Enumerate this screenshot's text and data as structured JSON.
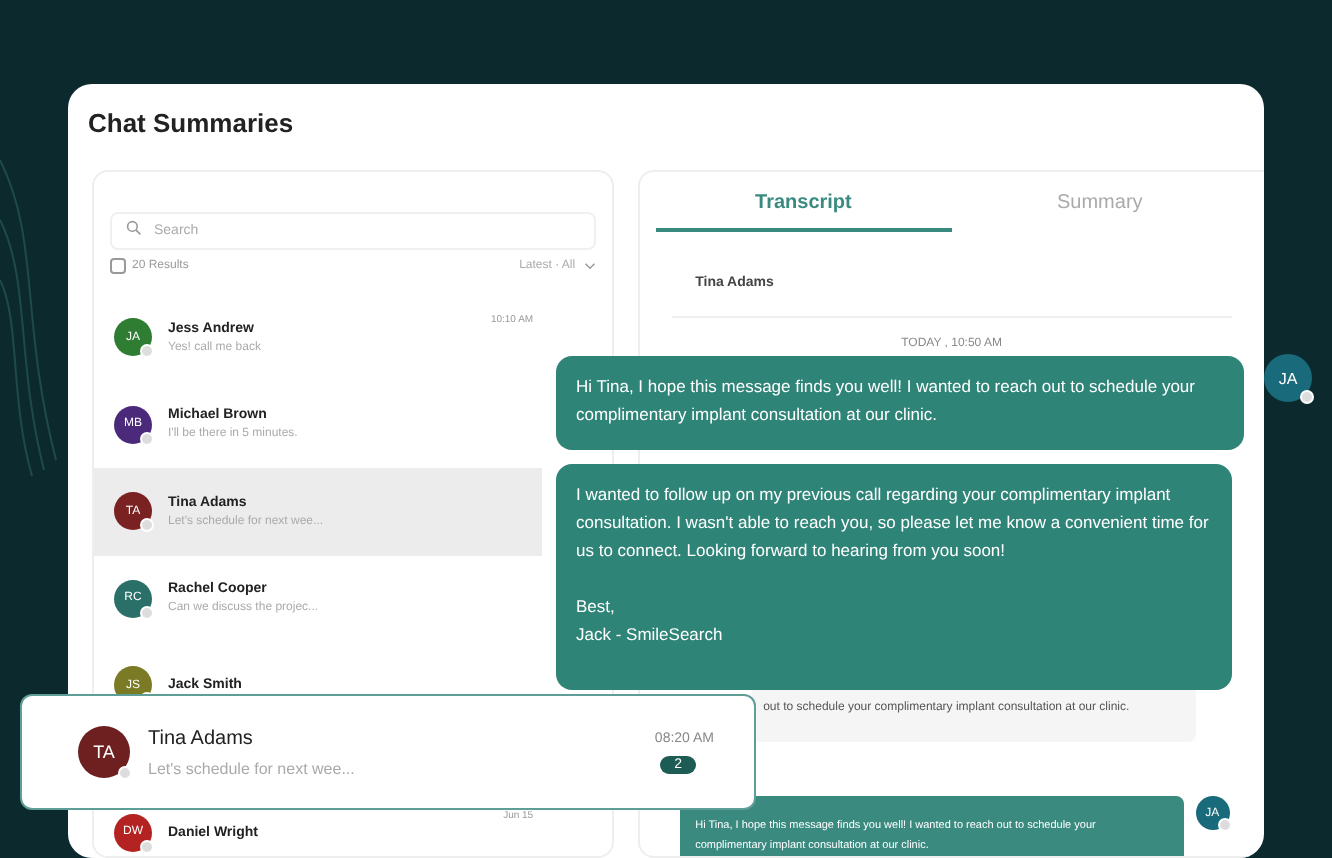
{
  "title": "Chat Summaries",
  "search": {
    "placeholder": "Search"
  },
  "results": {
    "label": "20 Results",
    "checked": false
  },
  "filter": {
    "label": "Latest · All"
  },
  "contacts": [
    {
      "initials": "JA",
      "name": "Jess Andrew",
      "preview": "Yes! call me back",
      "time": "10:10 AM",
      "color": "#2e7d32",
      "selected": false
    },
    {
      "initials": "MB",
      "name": "Michael Brown",
      "preview": "I'll be there in 5 minutes.",
      "color": "#4b2a7b",
      "selected": false
    },
    {
      "initials": "TA",
      "name": "Tina Adams",
      "preview": "Let's schedule for next wee...",
      "color": "#7a2222",
      "selected": true
    },
    {
      "initials": "RC",
      "name": "Rachel Cooper",
      "preview": "Can we discuss the projec...",
      "color": "#2b6f69",
      "selected": false
    },
    {
      "initials": "JS",
      "name": "Jack Smith",
      "color": "#7b7a25",
      "selected": false
    },
    {
      "initials": "DW",
      "name": "Daniel Wright",
      "time": "Jun 15",
      "color": "#b52222",
      "selected": false
    }
  ],
  "tabs": [
    {
      "label": "Transcript",
      "selected": true
    },
    {
      "label": "Summary",
      "selected": false
    }
  ],
  "transcript": {
    "contact": "Tina Adams",
    "date": "TODAY , 10:50 AM",
    "messages": [
      {
        "kind": "incoming",
        "text": "out to schedule your complimentary implant consultation at our clinic."
      },
      {
        "kind": "outgoing",
        "text": "Hi Tina, I hope this message finds you well! I wanted to reach out to schedule your complimentary implant consultation at our clinic.",
        "avatar": "JA"
      }
    ]
  },
  "floating_messages": [
    {
      "text": "Hi Tina, I hope this message finds you well! I wanted to reach out to schedule your complimentary implant consultation at our clinic.",
      "avatar": "JA"
    },
    {
      "text": "I wanted to follow up on my previous call regarding your complimentary implant consultation. I wasn't able to reach you, so please let me know a convenient time for us to connect. Looking forward to hearing from you soon!\n\nBest,\nJack - SmileSearch"
    }
  ],
  "floating_contact": {
    "initials": "TA",
    "name": "Tina Adams",
    "preview": "Let's schedule for next wee...",
    "time": "08:20 AM",
    "unread": "2",
    "color": "#6e1f1f"
  }
}
